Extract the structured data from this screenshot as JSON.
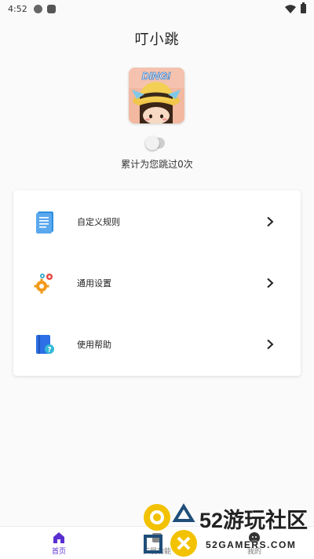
{
  "status_bar": {
    "time": "4:52"
  },
  "app": {
    "title": "叮小跳"
  },
  "logo": {
    "text": "DING!"
  },
  "counter": {
    "text": "累计为您跳过0次"
  },
  "menu": {
    "items": [
      {
        "label": "自定义规则",
        "icon": "document-icon"
      },
      {
        "label": "通用设置",
        "icon": "gears-icon"
      },
      {
        "label": "使用帮助",
        "icon": "help-book-icon"
      }
    ]
  },
  "nav": {
    "items": [
      {
        "label": "首页",
        "icon": "home-icon",
        "active": true
      },
      {
        "label": "扩展功能",
        "icon": "extension-icon",
        "active": false
      },
      {
        "label": "我的",
        "icon": "profile-icon",
        "active": false
      }
    ]
  },
  "watermark": {
    "title": "52游玩社区",
    "subtitle": "52GAMERS.COM"
  },
  "colors": {
    "accent": "#5a2fd0",
    "doc_icon": "#2f8fe0",
    "gear_orange": "#f39a1b",
    "help_blue": "#2c6fe6",
    "watermark_yellow": "#f2c200"
  }
}
